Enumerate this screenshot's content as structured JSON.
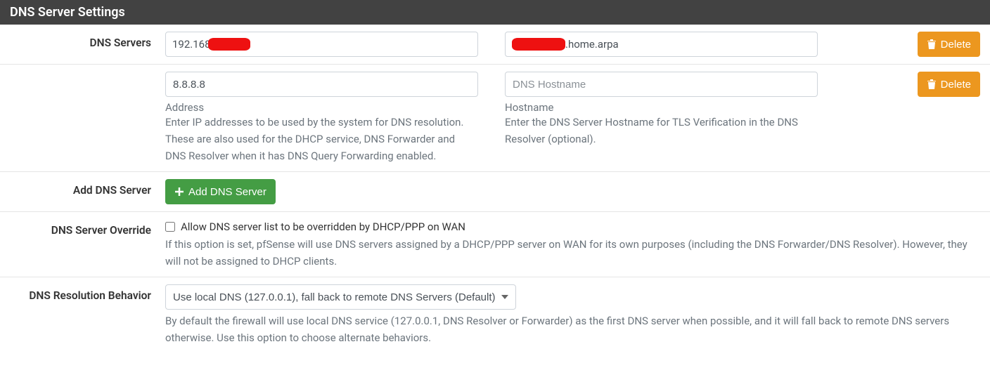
{
  "panel_title": "DNS Server Settings",
  "labels": {
    "dns_servers": "DNS Servers",
    "add_dns_server": "Add DNS Server",
    "dns_server_override": "DNS Server Override",
    "dns_resolution_behavior": "DNS Resolution Behavior"
  },
  "dns_rows": [
    {
      "address_prefix": "192.168",
      "address_redacted": true,
      "hostname_suffix": ".home.arpa",
      "hostname_redacted": true
    },
    {
      "address": "8.8.8.8",
      "hostname": "",
      "hostname_placeholder": "DNS Hostname"
    }
  ],
  "field_labels": {
    "address": "Address",
    "hostname": "Hostname"
  },
  "help": {
    "address": "Enter IP addresses to be used by the system for DNS resolution. These are also used for the DHCP service, DNS Forwarder and DNS Resolver when it has DNS Query Forwarding enabled.",
    "hostname": "Enter the DNS Server Hostname for TLS Verification in the DNS Resolver (optional).",
    "override": "If this option is set, pfSense will use DNS servers assigned by a DHCP/PPP server on WAN for its own purposes (including the DNS Forwarder/DNS Resolver). However, they will not be assigned to DHCP clients.",
    "resolution": "By default the firewall will use local DNS service (127.0.0.1, DNS Resolver or Forwarder) as the first DNS server when possible, and it will fall back to remote DNS servers otherwise. Use this option to choose alternate behaviors."
  },
  "buttons": {
    "delete": "Delete",
    "add": "Add DNS Server"
  },
  "override_checkbox": {
    "checked": false,
    "label": "Allow DNS server list to be overridden by DHCP/PPP on WAN"
  },
  "resolution_select": {
    "selected": "Use local DNS (127.0.0.1), fall back to remote DNS Servers (Default)"
  }
}
